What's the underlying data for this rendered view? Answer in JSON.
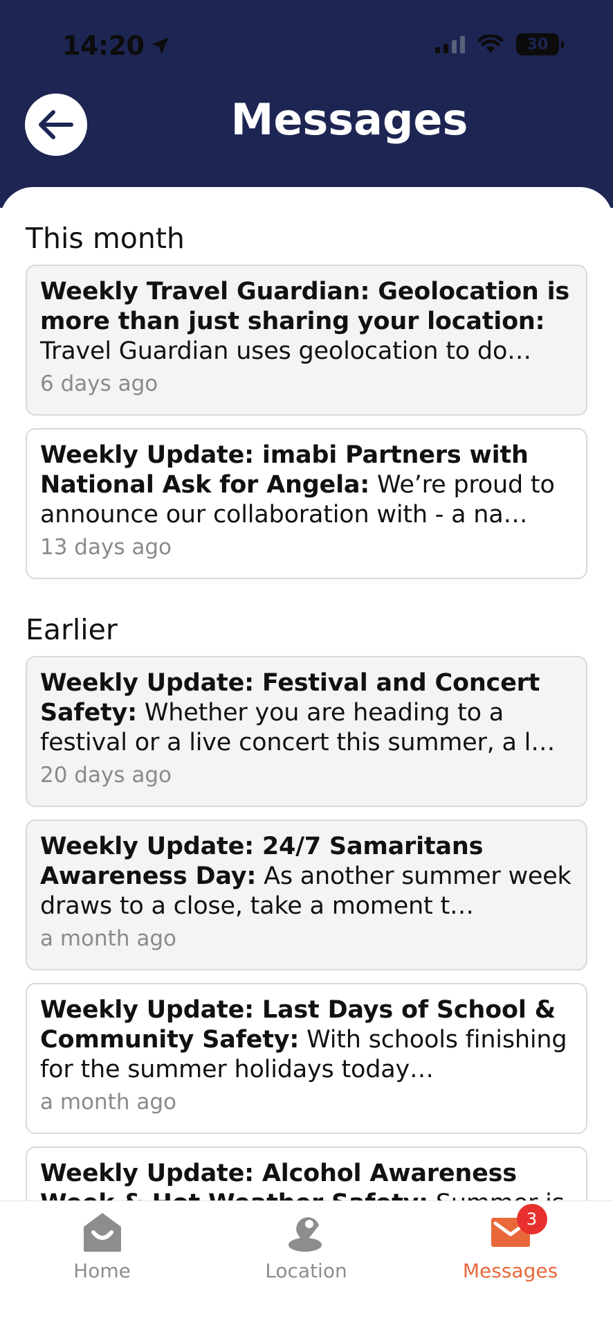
{
  "status_bar": {
    "time": "14:20",
    "battery": "30"
  },
  "header": {
    "title": "Messages"
  },
  "sections": [
    {
      "title": "This month",
      "messages": [
        {
          "title": "Weekly Travel Guardian: Geolocation is more than just sharing your location:",
          "preview": "Travel Guardian uses geolocation to do…",
          "when": "6 days ago",
          "read": true
        },
        {
          "title": "Weekly Update: imabi Partners with National Ask for Angela:",
          "preview": "We’re proud to announce our collaboration with  - a na…",
          "when": "13 days ago",
          "read": false
        }
      ]
    },
    {
      "title": "Earlier",
      "messages": [
        {
          "title": "Weekly Update: Festival and Concert Safety:",
          "preview": "Whether you are heading to a festival or a live concert this summer, a l…",
          "when": "20 days ago",
          "read": true
        },
        {
          "title": "Weekly Update: 24/7 Samaritans Awareness Day:",
          "preview": "As another summer week draws to a close, take a moment t…",
          "when": "a month ago",
          "read": true
        },
        {
          "title": "Weekly Update: Last Days of School & Community Safety:",
          "preview": "With schools finishing for the summer holidays today…",
          "when": "a month ago",
          "read": false
        },
        {
          "title": "Weekly Update: Alcohol Awareness Week & Hot Weather Safety:",
          "preview": "Summer is",
          "when": "",
          "read": false
        }
      ]
    }
  ],
  "tabbar": {
    "home": "Home",
    "location": "Location",
    "messages": "Messages",
    "messages_badge": "3"
  },
  "colors": {
    "header": "#1d2553",
    "accent": "#e8683a",
    "badge": "#e8312f",
    "inactive": "#8d8d8d"
  },
  "icons": {
    "back": "arrow-left-icon",
    "home": "home-icon",
    "location": "location-pin-icon",
    "messages": "envelope-icon",
    "status_location": "location-arrow-icon",
    "wifi": "wifi-icon"
  }
}
